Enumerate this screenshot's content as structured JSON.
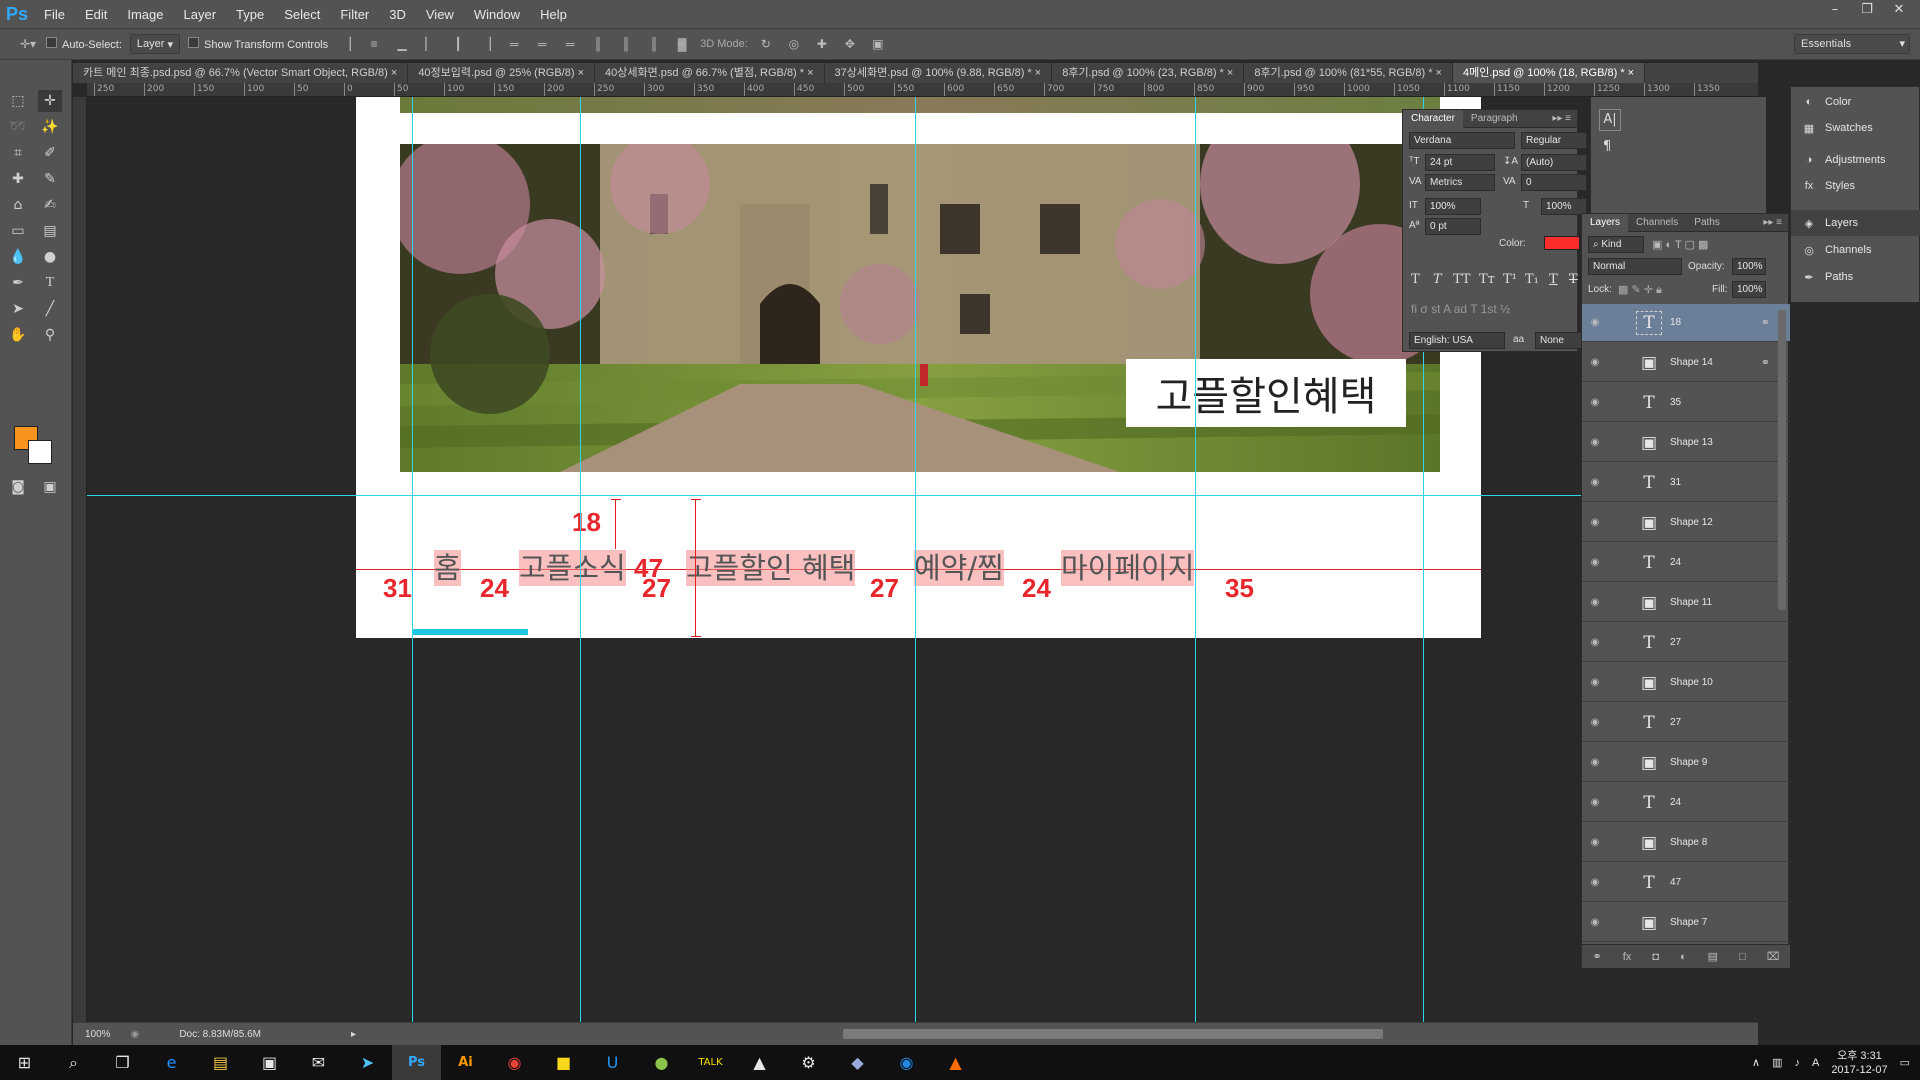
{
  "app": {
    "logo": "Ps",
    "menu": [
      "File",
      "Edit",
      "Image",
      "Layer",
      "Type",
      "Select",
      "Filter",
      "3D",
      "View",
      "Window",
      "Help"
    ]
  },
  "options": {
    "auto_select_label": "Auto-Select:",
    "auto_select_value": "Layer",
    "show_transform_label": "Show Transform Controls",
    "mode_3d_label": "3D Mode:",
    "workspace": "Essentials"
  },
  "tabs": [
    {
      "label": "카트 메인 최종.psd.psd @ 66.7% (Vector Smart Object, RGB/8)"
    },
    {
      "label": "40정보입력.psd @ 25% (RGB/8)"
    },
    {
      "label": "40상세화면.psd @ 66.7% (별점, RGB/8) *"
    },
    {
      "label": "37상세화면.psd @ 100% (9.88, RGB/8) *"
    },
    {
      "label": "8후기.psd @ 100% (23, RGB/8) *"
    },
    {
      "label": "8후기.psd @ 100% (81*55, RGB/8) *"
    },
    {
      "label": "4메인.psd @ 100% (18, RGB/8) *"
    }
  ],
  "ruler": [
    "250",
    "200",
    "150",
    "100",
    "50",
    "0",
    "50",
    "100",
    "150",
    "200",
    "250",
    "300",
    "350",
    "400",
    "450",
    "500",
    "550",
    "600",
    "650",
    "700",
    "750",
    "800",
    "850",
    "900",
    "950",
    "1000",
    "1050",
    "1100",
    "1150",
    "1200",
    "1250",
    "1300",
    "1350"
  ],
  "canvas": {
    "hero_banner": "고플할인혜택",
    "nav_items": [
      "홈",
      "고플소식",
      "고플할인 혜택",
      "예약/찜",
      "마이페이지"
    ],
    "spacing_labels": [
      "18",
      "31",
      "24",
      "47",
      "27",
      "27",
      "24",
      "35"
    ]
  },
  "status": {
    "zoom": "100%",
    "doc": "Doc: 8.83M/85.6M"
  },
  "character": {
    "tabs": [
      "Character",
      "Paragraph"
    ],
    "font_family": "Verdana",
    "font_style": "Regular",
    "size": "24 pt",
    "leading": "(Auto)",
    "kerning": "Metrics",
    "tracking": "0",
    "vscale": "100%",
    "hscale": "100%",
    "baseline": "0 pt",
    "color_label": "Color:",
    "color": "#ff2c2c",
    "language": "English: USA",
    "aa_label": "aa",
    "antialias": "None"
  },
  "layers": {
    "tabs": [
      "Layers",
      "Channels",
      "Paths"
    ],
    "kind": "Kind",
    "blend": "Normal",
    "opacity_label": "Opacity:",
    "opacity": "100%",
    "lock_label": "Lock:",
    "fill_label": "Fill:",
    "fill": "100%",
    "items": [
      {
        "name": "18",
        "type": "text",
        "selected": true,
        "linked": true
      },
      {
        "name": "Shape 14",
        "type": "shape",
        "linked": true
      },
      {
        "name": "35",
        "type": "text"
      },
      {
        "name": "Shape 13",
        "type": "shape"
      },
      {
        "name": "31",
        "type": "text"
      },
      {
        "name": "Shape 12",
        "type": "shape"
      },
      {
        "name": "24",
        "type": "text"
      },
      {
        "name": "Shape 11",
        "type": "shape"
      },
      {
        "name": "27",
        "type": "text"
      },
      {
        "name": "Shape 10",
        "type": "shape"
      },
      {
        "name": "27",
        "type": "text"
      },
      {
        "name": "Shape 9",
        "type": "shape"
      },
      {
        "name": "24",
        "type": "text"
      },
      {
        "name": "Shape 8",
        "type": "shape"
      },
      {
        "name": "47",
        "type": "text"
      },
      {
        "name": "Shape 7",
        "type": "shape"
      }
    ]
  },
  "dock": [
    "Color",
    "Swatches",
    "Adjustments",
    "Styles",
    "Layers",
    "Channels",
    "Paths"
  ],
  "taskbar": {
    "time": "오후 3:31",
    "date": "2017-12-07",
    "ime": "A"
  }
}
